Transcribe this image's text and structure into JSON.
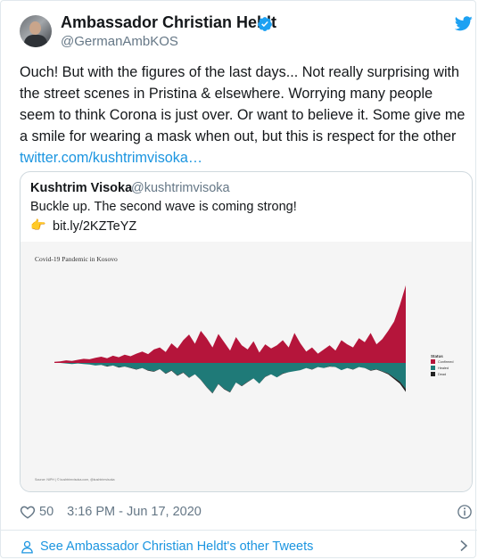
{
  "tweet": {
    "author_name": "Ambassador Christian Heldt",
    "author_handle": "@GermanAmbKOS",
    "text": "Ouch! But with the figures of the last days... Not really surprising with the street scenes in Pristina & elsewhere. Worrying many people seem to think Corona is just over. Or want to believe it. Some give me a smile for wearing a mask when out, but this is respect for the other ",
    "link_text": "twitter.com/kushtrimvisoka…",
    "likes": "50",
    "timestamp": "3:16 PM - Jun 17, 2020",
    "more_tweets_label": "See Ambassador Christian Heldt's other Tweets"
  },
  "quoted": {
    "author_name": "Kushtrim Visoka",
    "author_handle": "@kushtrimvisoka",
    "text": "Buckle up. The second wave is coming strong!",
    "pointer_emoji": "👉",
    "link_text": "bit.ly/2KZTeYZ"
  },
  "chart_data": {
    "type": "area",
    "title": "Covid-19 Pandemic in Kosovo",
    "source": "Source: NIPH | © kushtrimvisoka.com, @kushtrimvisoka",
    "legend_title": "Status",
    "series": [
      {
        "name": "Confirmed",
        "color": "#b5153b",
        "values": [
          2,
          3,
          5,
          4,
          6,
          8,
          7,
          10,
          12,
          9,
          14,
          11,
          16,
          13,
          18,
          22,
          17,
          26,
          30,
          21,
          38,
          28,
          44,
          55,
          37,
          62,
          48,
          30,
          56,
          40,
          24,
          50,
          34,
          26,
          42,
          20,
          36,
          28,
          34,
          44,
          30,
          58,
          38,
          22,
          30,
          18,
          26,
          34,
          24,
          44,
          36,
          30,
          48,
          40,
          58,
          36,
          46,
          62,
          80,
          112,
          150
        ]
      },
      {
        "name": "Healed",
        "color": "#1f7a78",
        "values": [
          0,
          0,
          1,
          2,
          1,
          2,
          3,
          5,
          4,
          6,
          5,
          8,
          7,
          9,
          12,
          10,
          14,
          16,
          12,
          20,
          14,
          24,
          18,
          28,
          22,
          32,
          46,
          58,
          40,
          50,
          56,
          38,
          44,
          36,
          30,
          40,
          26,
          22,
          28,
          20,
          18,
          16,
          14,
          10,
          12,
          8,
          10,
          6,
          8,
          14,
          10,
          12,
          8,
          10,
          14,
          12,
          16,
          20,
          28,
          36,
          50
        ]
      },
      {
        "name": "Dead",
        "color": "#222222",
        "values": [
          0,
          0,
          0,
          0,
          0,
          0,
          0,
          0,
          0,
          1,
          0,
          1,
          0,
          1,
          1,
          0,
          1,
          1,
          0,
          1,
          1,
          1,
          1,
          1,
          0,
          1,
          1,
          1,
          1,
          1,
          1,
          0,
          1,
          1,
          0,
          0,
          1,
          0,
          0,
          1,
          0,
          0,
          0,
          0,
          1,
          0,
          0,
          1,
          0,
          0,
          0,
          1,
          0,
          0,
          1,
          1,
          1,
          2,
          3,
          4,
          6
        ]
      }
    ]
  },
  "colors": {
    "brand": "#1da1f2",
    "link": "#1b95e0",
    "verified": "#1da1f2"
  },
  "icons": {
    "verified": "verified-badge-icon",
    "bird": "twitter-bird-icon",
    "heart": "heart-icon",
    "info": "info-icon",
    "person": "person-icon",
    "chevron": "chevron-right-icon"
  }
}
